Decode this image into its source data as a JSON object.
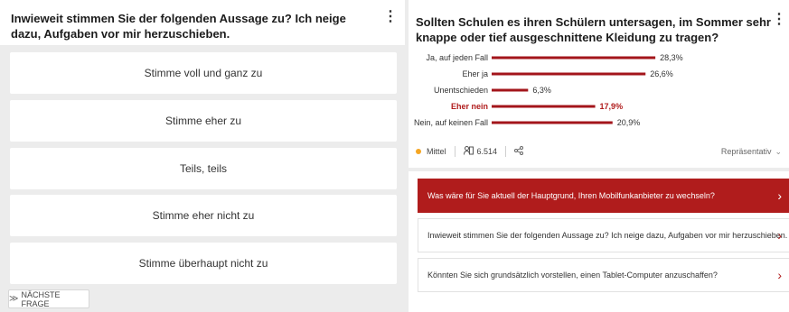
{
  "left": {
    "question": "Inwieweit stimmen Sie der folgenden Aussage zu? Ich neige dazu, Aufgaben vor mir herzuschieben.",
    "menu_icon": "⋮",
    "answers": [
      "Stimme voll und ganz zu",
      "Stimme eher zu",
      "Teils, teils",
      "Stimme eher nicht zu",
      "Stimme überhaupt nicht zu"
    ],
    "next_label": "NÄCHSTE FRAGE",
    "next_icon": "≫"
  },
  "right": {
    "question": "Sollten Schulen es ihren Schülern untersagen, im Sommer sehr knappe oder tief ausgeschnittene Kleidung zu tragen?",
    "menu_icon": "⋮",
    "meta": {
      "quality_label": "Mittel",
      "quality_color": "#f5a623",
      "respondents_icon": "👥",
      "respondents": "6.514",
      "share_icon": "share-icon",
      "representative_label": "Repräsentativ",
      "chevron": "⌄"
    },
    "related": [
      {
        "label": "Was wäre für Sie aktuell der Hauptgrund, Ihren Mobilfunkanbieter zu wechseln?",
        "active": true
      },
      {
        "label": "Inwieweit stimmen Sie der folgenden Aussage zu? Ich neige dazu, Aufgaben vor mir herzuschieben.",
        "active": false
      },
      {
        "label": "Könnten Sie sich grundsätzlich vorstellen, einen Tablet-Computer anzuschaffen?",
        "active": false
      }
    ],
    "arrow_icon": "›"
  },
  "chart_data": {
    "type": "bar",
    "orientation": "horizontal",
    "categories": [
      "Ja, auf jeden Fall",
      "Eher ja",
      "Unentschieden",
      "Eher nein",
      "Nein, auf keinen Fall"
    ],
    "values": [
      28.3,
      26.6,
      6.3,
      17.9,
      20.9
    ],
    "value_labels": [
      "28,3%",
      "26,6%",
      "6,3%",
      "17,9%",
      "20,9%"
    ],
    "highlighted_category": "Eher nein",
    "bar_color": "#a3151b",
    "highlight_text_color": "#b01c1c",
    "xlim": [
      0,
      30
    ],
    "grid": false,
    "legend": "none"
  }
}
